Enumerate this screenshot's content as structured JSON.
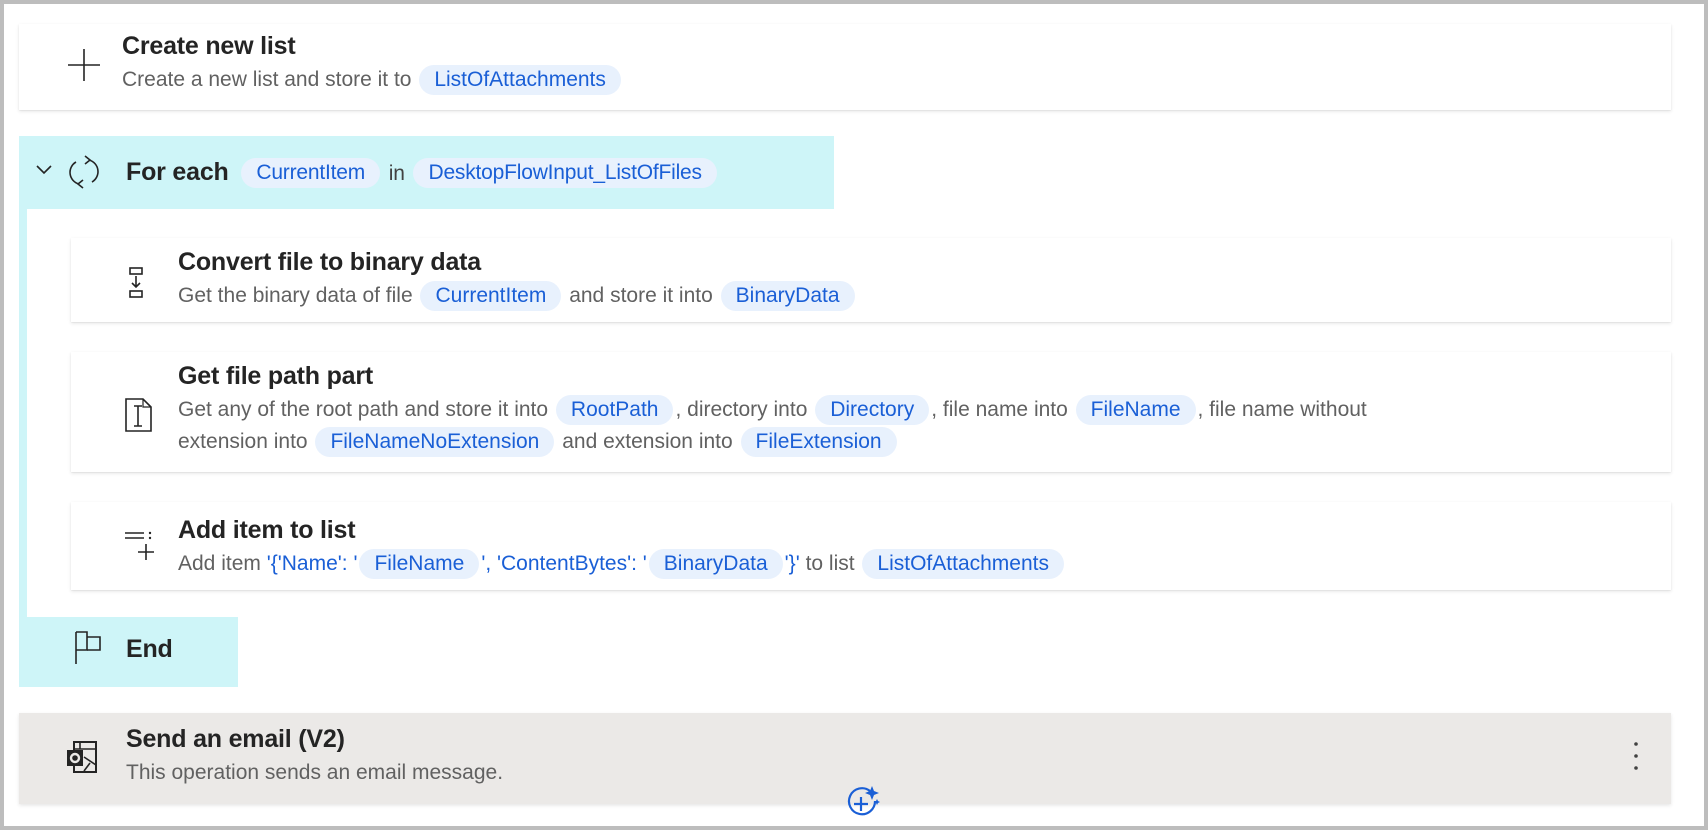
{
  "steps": {
    "create_list": {
      "icon": "plus-icon",
      "title": "Create new list",
      "desc_prefix": "Create a new list and store it to",
      "var": "ListOfAttachments"
    },
    "for_each": {
      "icon": "loop-icon",
      "collapse_icon": "chevron-down-icon",
      "title": "For each",
      "item_var": "CurrentItem",
      "in_label": "in",
      "list_var": "DesktopFlowInput_ListOfFiles"
    },
    "convert_file": {
      "icon": "convert-binary-icon",
      "title": "Convert file to binary data",
      "desc_prefix": "Get the binary data of file",
      "file_var": "CurrentItem",
      "desc_mid": "and store it into",
      "out_var": "BinaryData"
    },
    "get_path_part": {
      "icon": "file-text-icon",
      "title": "Get file path part",
      "line1_a": "Get any of the root path and store it into",
      "root_var": "RootPath",
      "line1_b": ", directory into",
      "dir_var": "Directory",
      "line1_c": ", file name into",
      "name_var": "FileName",
      "line1_d": ", file name without",
      "line2_a": "extension into",
      "noext_var": "FileNameNoExtension",
      "line2_b": "and extension into",
      "ext_var": "FileExtension"
    },
    "add_item": {
      "icon": "add-to-list-icon",
      "title": "Add item to list",
      "desc_prefix": "Add item",
      "lit1": "'{'Name': '",
      "name_var": "FileName",
      "lit2": "', 'ContentBytes': '",
      "data_var": "BinaryData",
      "lit3": "'}'",
      "desc_mid": "to list",
      "list_var": "ListOfAttachments"
    },
    "end": {
      "icon": "flag-icon",
      "title": "End"
    },
    "send_email": {
      "icon": "outlook-icon",
      "title": "Send an email (V2)",
      "desc": "This operation sends an email message.",
      "more_icon": "more-vertical-icon"
    }
  },
  "add_step_button": {
    "icon": "add-sparkle-icon"
  },
  "colors": {
    "loop_highlight": "#cef5f8",
    "chip_bg": "#e8f1fd",
    "chip_text": "#1a5fd6",
    "email_card_bg": "#ebe9e7"
  }
}
